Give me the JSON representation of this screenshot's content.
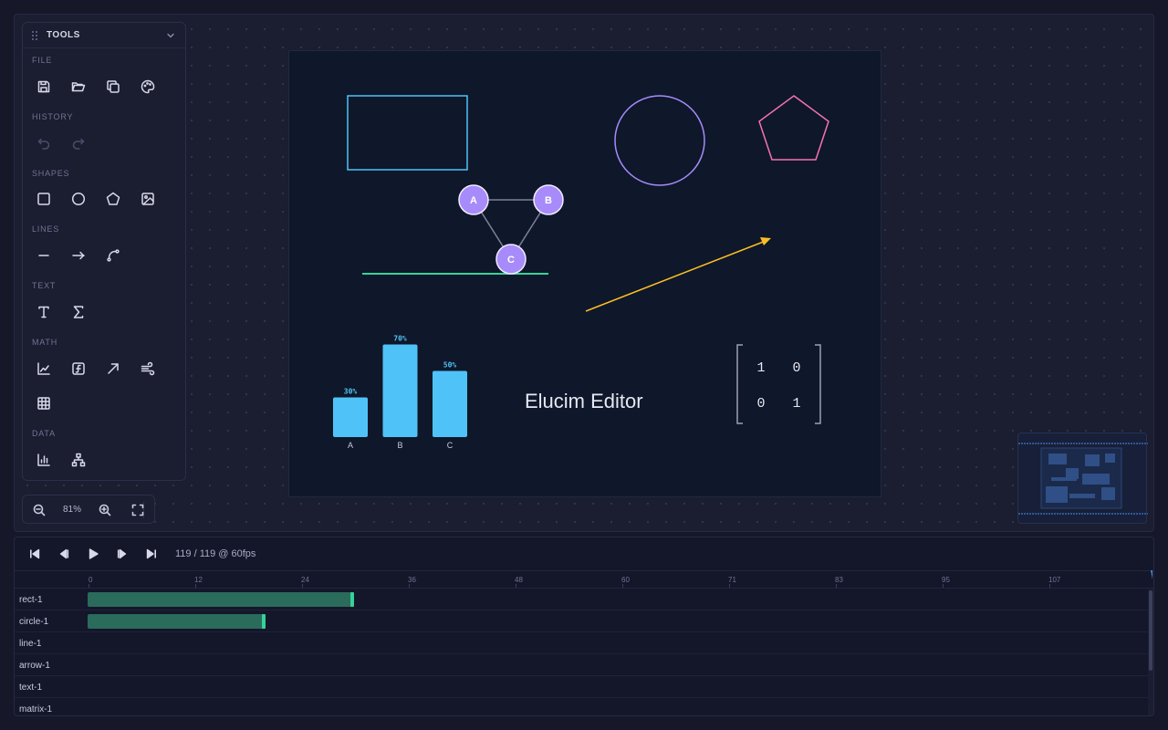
{
  "tools_panel": {
    "title": "TOOLS",
    "groups": {
      "file": "FILE",
      "history": "HISTORY",
      "shapes": "SHAPES",
      "lines": "LINES",
      "text": "TEXT",
      "math": "MATH",
      "data": "DATA"
    },
    "icons": [
      "save-icon",
      "open-folder-icon",
      "duplicate-icon",
      "palette-icon",
      "undo-icon",
      "redo-icon",
      "rectangle-icon",
      "circle-icon",
      "pentagon-icon",
      "image-icon",
      "line-icon",
      "arrow-icon",
      "curve-icon",
      "text-icon",
      "sigma-icon",
      "graph-icon",
      "function-icon",
      "vector-icon",
      "vector-field-icon",
      "matrix-icon",
      "bar-chart-icon",
      "tree-icon"
    ]
  },
  "zoom": {
    "value": "81%"
  },
  "canvas": {
    "background": "#0f172a",
    "text_label": "Elucim Editor",
    "graph_nodes": [
      "A",
      "B",
      "C"
    ],
    "matrix": [
      [
        "1",
        "0"
      ],
      [
        "0",
        "1"
      ]
    ],
    "colors": {
      "rect": "#4fc3f7",
      "circle": "#a78bfa",
      "pentagon": "#f472b6",
      "arrow": "#fbbf24",
      "line": "#34d399",
      "bars": "#4fc3f7",
      "nodes": "#a78bfa"
    }
  },
  "chart_data": {
    "type": "bar",
    "categories": [
      "A",
      "B",
      "C"
    ],
    "values": [
      30,
      70,
      50
    ],
    "value_labels": [
      "30%",
      "70%",
      "50%"
    ],
    "ylim": [
      0,
      80
    ]
  },
  "timeline": {
    "frame_info": "119 / 119 @ 60fps",
    "ticks": [
      "0",
      "12",
      "24",
      "36",
      "48",
      "60",
      "71",
      "83",
      "95",
      "107"
    ],
    "tracks": [
      {
        "name": "rect-1",
        "start_frame": 0,
        "end_frame": 30
      },
      {
        "name": "circle-1",
        "start_frame": 0,
        "end_frame": 20
      },
      {
        "name": "line-1"
      },
      {
        "name": "arrow-1"
      },
      {
        "name": "text-1"
      },
      {
        "name": "matrix-1"
      }
    ]
  }
}
